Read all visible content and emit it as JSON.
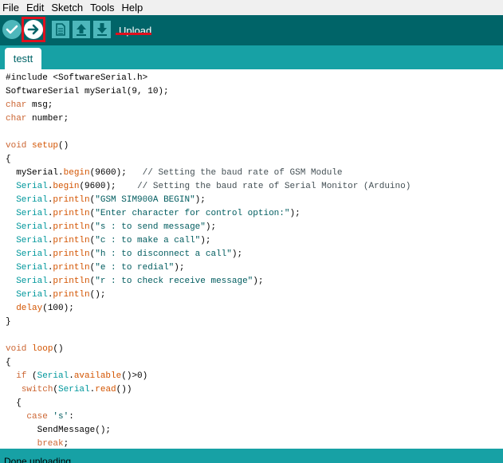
{
  "menu": [
    "File",
    "Edit",
    "Sketch",
    "Tools",
    "Help"
  ],
  "toolbar": {
    "buttons": [
      "verify-icon",
      "upload-icon",
      "new-icon",
      "open-icon",
      "save-icon"
    ],
    "status_label": "Upload",
    "highlight_color": "#e0101e",
    "bar_color": "#006468",
    "button_color": "#4db7bb"
  },
  "tabs": [
    {
      "label": "testt"
    }
  ],
  "editor": {
    "lines": [
      "#include <SoftwareSerial.h>",
      "SoftwareSerial mySerial(9, 10);",
      "char msg;",
      "char number;",
      "",
      "void setup()",
      "{",
      "  mySerial.begin(9600);   // Setting the baud rate of GSM Module",
      "  Serial.begin(9600);    // Setting the baud rate of Serial Monitor (Arduino)",
      "  Serial.println(\"GSM SIM900A BEGIN\");",
      "  Serial.println(\"Enter character for control option:\");",
      "  Serial.println(\"s : to send message\");",
      "  Serial.println(\"c : to make a call\");",
      "  Serial.println(\"h : to disconnect a call\");",
      "  Serial.println(\"e : to redial\");",
      "  Serial.println(\"r : to check receive message\");",
      "  Serial.println();",
      "  delay(100);",
      "}",
      "",
      "void loop()",
      "{",
      "  if (Serial.available()>0)",
      "   switch(Serial.read())",
      "  {",
      "    case 's':",
      "      SendMessage();",
      "      break;"
    ]
  },
  "status": {
    "text": "Done uploading."
  }
}
